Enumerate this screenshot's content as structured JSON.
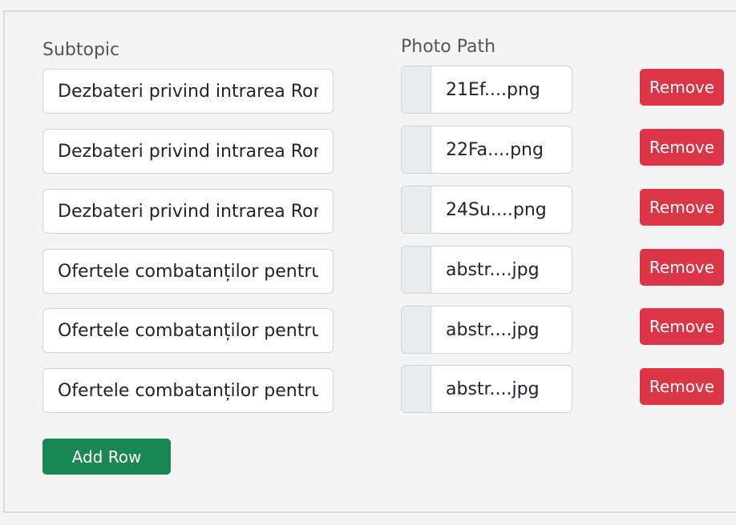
{
  "labels": {
    "subtopic": "Subtopic",
    "photo_path": "Photo Path"
  },
  "rows": [
    {
      "subtopic": "Dezbateri privind intrarea Roma",
      "photo_file": "21Ef....png",
      "remove_label": "Remove"
    },
    {
      "subtopic": "Dezbateri privind intrarea Roma",
      "photo_file": "22Fa....png",
      "remove_label": "Remove"
    },
    {
      "subtopic": "Dezbateri privind intrarea Roma",
      "photo_file": "24Su....png",
      "remove_label": "Remove"
    },
    {
      "subtopic": "Ofertele combatanților pentru i",
      "photo_file": "abstr....jpg",
      "remove_label": "Remove"
    },
    {
      "subtopic": "Ofertele combatanților pentru i",
      "photo_file": "abstr....jpg",
      "remove_label": "Remove"
    },
    {
      "subtopic": "Ofertele combatanților pentru i",
      "photo_file": "abstr....jpg",
      "remove_label": "Remove"
    }
  ],
  "add_row_label": "Add Row",
  "colors": {
    "remove": "#dc3545",
    "add": "#198754",
    "background": "#f4f4f4"
  }
}
